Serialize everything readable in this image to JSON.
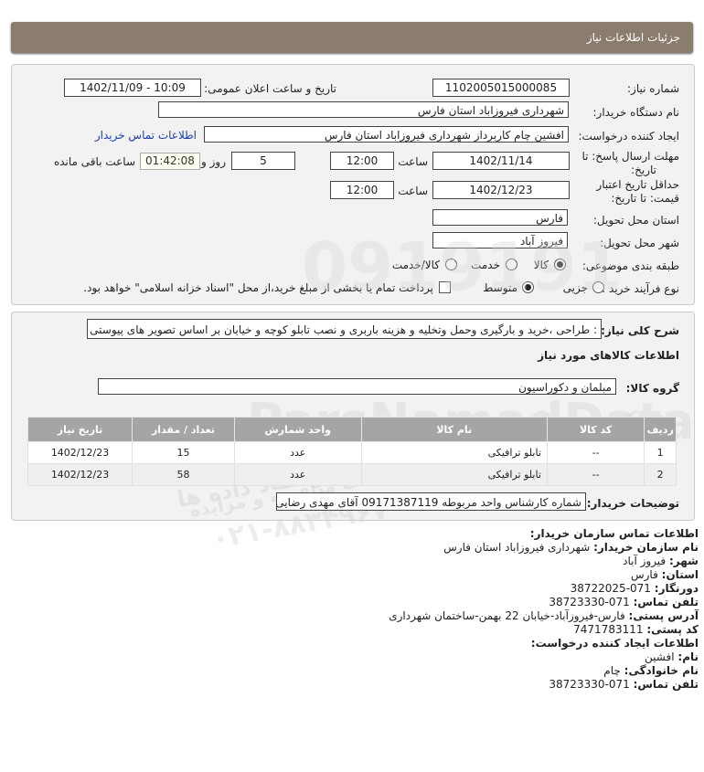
{
  "header": {
    "title": "جزئیات اطلاعات نیاز"
  },
  "form": {
    "need_number_label": "شماره نیاز:",
    "need_number": "1102005015000085",
    "announce_label": "تاریخ و ساعت اعلان عمومی:",
    "announce_value": "1402/11/09 - 10:09",
    "buyer_label": "نام دستگاه خریدار:",
    "buyer_value": "شهرداری فیروزاباد استان فارس",
    "creator_label": "ایجاد کننده درخواست:",
    "creator_value": "افشین چام کاربرداز شهرداری فیروزاباد استان فارس",
    "contact_link": "اطلاعات تماس خریدار",
    "deadline_label_1": "مهلت ارسال پاسخ: تا",
    "deadline_label_2": "تاریخ:",
    "deadline_date": "1402/11/14",
    "time_label": "ساعت",
    "deadline_time": "12:00",
    "days_value": "5",
    "days_label": "روز و",
    "remaining_time": "01:42:08",
    "remaining_label": "ساعت باقی مانده",
    "validity_label_1": "حداقل تاریخ اعتبار",
    "validity_label_2": "قیمت: تا تاریخ:",
    "validity_date": "1402/12/23",
    "validity_time": "12:00",
    "province_label": "استان محل تحویل:",
    "province_value": "فارس",
    "city_label": "شهر محل تحویل:",
    "city_value": "فیروز آباد",
    "category_label": "طبقه بندی موضوعی:",
    "category_options": [
      "کالا",
      "خدمت",
      "کالا/خدمت"
    ],
    "category_selected": "کالا",
    "process_label": "نوع فرآیند خرید :",
    "process_options": [
      "جزیی",
      "متوسط"
    ],
    "process_selected": "متوسط",
    "payment_note": "پرداخت تمام یا بخشی از مبلغ خرید،از محل \"اسناد خزانه اسلامی\" خواهد بود."
  },
  "description": {
    "label": "شرح کلی نیاز:",
    "value": ": طراحی ،خرید و بارگیری وحمل وتخلیه و هزینه باربری و نصب تابلو کوچه و خیابان بر اساس تصویر های پیوستی",
    "goods_info_title": "اطلاعات کالاهای مورد نیاز",
    "group_label": "گروه کالا:",
    "group_value": "مبلمان و دکوراسیون"
  },
  "table": {
    "headers": [
      "ردیف",
      "کد کالا",
      "نام کالا",
      "واحد شمارش",
      "تعداد / مقدار",
      "تاریخ نیاز"
    ],
    "rows": [
      [
        "1",
        "--",
        "تابلو ترافیکی",
        "عدد",
        "15",
        "1402/12/23"
      ],
      [
        "2",
        "--",
        "تابلو ترافیکی",
        "عدد",
        "58",
        "1402/12/23"
      ]
    ]
  },
  "buyer_notes": {
    "label": "توضیحات خریدار:",
    "value": "شماره کارشناس واحد مربوطه 09171387119 آقای مهدی رضایی"
  },
  "contact": {
    "title": "اطلاعات تماس سازمان خریدار:",
    "org_label": "نام سازمان خریدار:",
    "org_value": "شهرداری فیروزاباد استان فارس",
    "city_label": "شهر:",
    "city_value": "فیروز آباد",
    "province_label": "استان:",
    "province_value": "فارس",
    "fax_label": "دورنگار:",
    "fax_value": "071-38722025",
    "phone_label": "تلفن تماس:",
    "phone_value": "071-38723330",
    "address_label": "آدرس پستی:",
    "address_value": "فارس-فیروزآباد-خیابان 22 بهمن-ساختمان شهرداری",
    "postal_label": "کد پستی:",
    "postal_value": "7471783111",
    "creator_title": "اطلاعات ایجاد کننده درخواست:",
    "first_name_label": "نام:",
    "first_name_value": "افشین",
    "last_name_label": "نام خانوادگی:",
    "last_name_value": "چام",
    "creator_phone_label": "تلفن تماس:",
    "creator_phone_value": "071-38723330"
  },
  "watermark": {
    "number": "0919191",
    "brand": "ParsNamadData",
    "persian_1": "مرکز فراهم سازی اطلاعات پارس نماد داده ها",
    "persian_2": "پایگاه اطلاعات مناقصه و مزایده",
    "phone": "۰۲۱-۸۸۳۴۹۶۷۰-۵"
  }
}
